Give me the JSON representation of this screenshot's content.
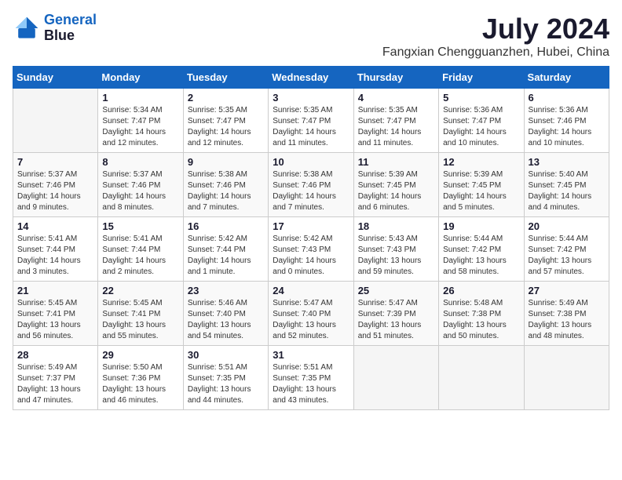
{
  "header": {
    "logo_line1": "General",
    "logo_line2": "Blue",
    "month_year": "July 2024",
    "location": "Fangxian Chengguanzhen, Hubei, China"
  },
  "days_of_week": [
    "Sunday",
    "Monday",
    "Tuesday",
    "Wednesday",
    "Thursday",
    "Friday",
    "Saturday"
  ],
  "weeks": [
    [
      {
        "day": "",
        "info": ""
      },
      {
        "day": "1",
        "info": "Sunrise: 5:34 AM\nSunset: 7:47 PM\nDaylight: 14 hours\nand 12 minutes."
      },
      {
        "day": "2",
        "info": "Sunrise: 5:35 AM\nSunset: 7:47 PM\nDaylight: 14 hours\nand 12 minutes."
      },
      {
        "day": "3",
        "info": "Sunrise: 5:35 AM\nSunset: 7:47 PM\nDaylight: 14 hours\nand 11 minutes."
      },
      {
        "day": "4",
        "info": "Sunrise: 5:35 AM\nSunset: 7:47 PM\nDaylight: 14 hours\nand 11 minutes."
      },
      {
        "day": "5",
        "info": "Sunrise: 5:36 AM\nSunset: 7:47 PM\nDaylight: 14 hours\nand 10 minutes."
      },
      {
        "day": "6",
        "info": "Sunrise: 5:36 AM\nSunset: 7:46 PM\nDaylight: 14 hours\nand 10 minutes."
      }
    ],
    [
      {
        "day": "7",
        "info": "Sunrise: 5:37 AM\nSunset: 7:46 PM\nDaylight: 14 hours\nand 9 minutes."
      },
      {
        "day": "8",
        "info": "Sunrise: 5:37 AM\nSunset: 7:46 PM\nDaylight: 14 hours\nand 8 minutes."
      },
      {
        "day": "9",
        "info": "Sunrise: 5:38 AM\nSunset: 7:46 PM\nDaylight: 14 hours\nand 7 minutes."
      },
      {
        "day": "10",
        "info": "Sunrise: 5:38 AM\nSunset: 7:46 PM\nDaylight: 14 hours\nand 7 minutes."
      },
      {
        "day": "11",
        "info": "Sunrise: 5:39 AM\nSunset: 7:45 PM\nDaylight: 14 hours\nand 6 minutes."
      },
      {
        "day": "12",
        "info": "Sunrise: 5:39 AM\nSunset: 7:45 PM\nDaylight: 14 hours\nand 5 minutes."
      },
      {
        "day": "13",
        "info": "Sunrise: 5:40 AM\nSunset: 7:45 PM\nDaylight: 14 hours\nand 4 minutes."
      }
    ],
    [
      {
        "day": "14",
        "info": "Sunrise: 5:41 AM\nSunset: 7:44 PM\nDaylight: 14 hours\nand 3 minutes."
      },
      {
        "day": "15",
        "info": "Sunrise: 5:41 AM\nSunset: 7:44 PM\nDaylight: 14 hours\nand 2 minutes."
      },
      {
        "day": "16",
        "info": "Sunrise: 5:42 AM\nSunset: 7:44 PM\nDaylight: 14 hours\nand 1 minute."
      },
      {
        "day": "17",
        "info": "Sunrise: 5:42 AM\nSunset: 7:43 PM\nDaylight: 14 hours\nand 0 minutes."
      },
      {
        "day": "18",
        "info": "Sunrise: 5:43 AM\nSunset: 7:43 PM\nDaylight: 13 hours\nand 59 minutes."
      },
      {
        "day": "19",
        "info": "Sunrise: 5:44 AM\nSunset: 7:42 PM\nDaylight: 13 hours\nand 58 minutes."
      },
      {
        "day": "20",
        "info": "Sunrise: 5:44 AM\nSunset: 7:42 PM\nDaylight: 13 hours\nand 57 minutes."
      }
    ],
    [
      {
        "day": "21",
        "info": "Sunrise: 5:45 AM\nSunset: 7:41 PM\nDaylight: 13 hours\nand 56 minutes."
      },
      {
        "day": "22",
        "info": "Sunrise: 5:45 AM\nSunset: 7:41 PM\nDaylight: 13 hours\nand 55 minutes."
      },
      {
        "day": "23",
        "info": "Sunrise: 5:46 AM\nSunset: 7:40 PM\nDaylight: 13 hours\nand 54 minutes."
      },
      {
        "day": "24",
        "info": "Sunrise: 5:47 AM\nSunset: 7:40 PM\nDaylight: 13 hours\nand 52 minutes."
      },
      {
        "day": "25",
        "info": "Sunrise: 5:47 AM\nSunset: 7:39 PM\nDaylight: 13 hours\nand 51 minutes."
      },
      {
        "day": "26",
        "info": "Sunrise: 5:48 AM\nSunset: 7:38 PM\nDaylight: 13 hours\nand 50 minutes."
      },
      {
        "day": "27",
        "info": "Sunrise: 5:49 AM\nSunset: 7:38 PM\nDaylight: 13 hours\nand 48 minutes."
      }
    ],
    [
      {
        "day": "28",
        "info": "Sunrise: 5:49 AM\nSunset: 7:37 PM\nDaylight: 13 hours\nand 47 minutes."
      },
      {
        "day": "29",
        "info": "Sunrise: 5:50 AM\nSunset: 7:36 PM\nDaylight: 13 hours\nand 46 minutes."
      },
      {
        "day": "30",
        "info": "Sunrise: 5:51 AM\nSunset: 7:35 PM\nDaylight: 13 hours\nand 44 minutes."
      },
      {
        "day": "31",
        "info": "Sunrise: 5:51 AM\nSunset: 7:35 PM\nDaylight: 13 hours\nand 43 minutes."
      },
      {
        "day": "",
        "info": ""
      },
      {
        "day": "",
        "info": ""
      },
      {
        "day": "",
        "info": ""
      }
    ]
  ]
}
